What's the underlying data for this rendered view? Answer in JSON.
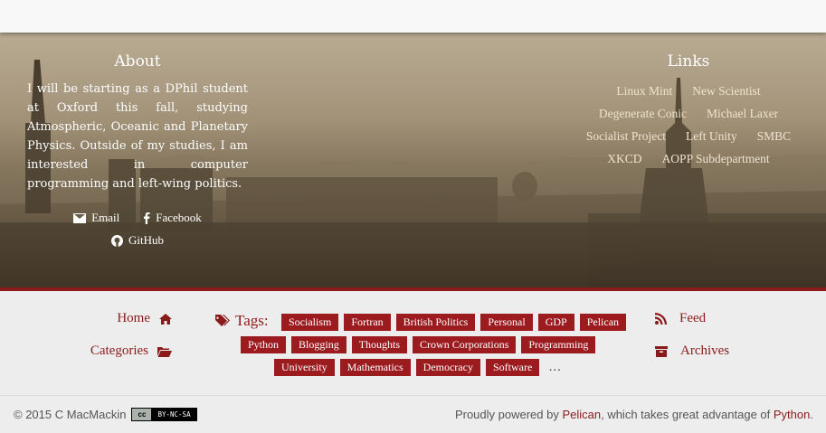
{
  "about": {
    "title": "About",
    "text": "I will be starting as a DPhil student at Oxford this fall, studying Atmospheric, Oceanic and Planetary Physics. Outside of my studies, I am interested in computer programming and left-wing politics.",
    "email": "Email",
    "facebook": "Facebook",
    "github": "GitHub"
  },
  "links": {
    "title": "Links",
    "rows": [
      [
        "Linux Mint",
        "New Scientist"
      ],
      [
        "Degenerate Conic",
        "Michael Laxer"
      ],
      [
        "Socialist Project",
        "Left Unity",
        "SMBC"
      ],
      [
        "XKCD",
        "AOPP Subdepartment"
      ]
    ]
  },
  "nav": {
    "home": "Home",
    "categories": "Categories",
    "feed": "Feed",
    "archives": "Archives"
  },
  "tags": {
    "label": "Tags:",
    "rows": [
      [
        "Socialism",
        "Fortran",
        "British Politics",
        "Personal",
        "GDP",
        "Pelican"
      ],
      [
        "Python",
        "Blogging",
        "Thoughts",
        "Crown Corporations",
        "Programming"
      ],
      [
        "University",
        "Mathematics",
        "Democracy",
        "Software"
      ]
    ],
    "more": "…"
  },
  "footer": {
    "copyright": "© 2015 C MacMackin",
    "license_left": "cc",
    "license_right": "BY-NC-SA",
    "powered_prefix": "Proudly powered by ",
    "pelican": "Pelican",
    "powered_middle": ", which takes great advantage of ",
    "python": "Python",
    "powered_suffix": "."
  },
  "colors": {
    "accent": "#8b1a1a",
    "tag_bg": "#9b1b1f",
    "background": "#ededed"
  }
}
